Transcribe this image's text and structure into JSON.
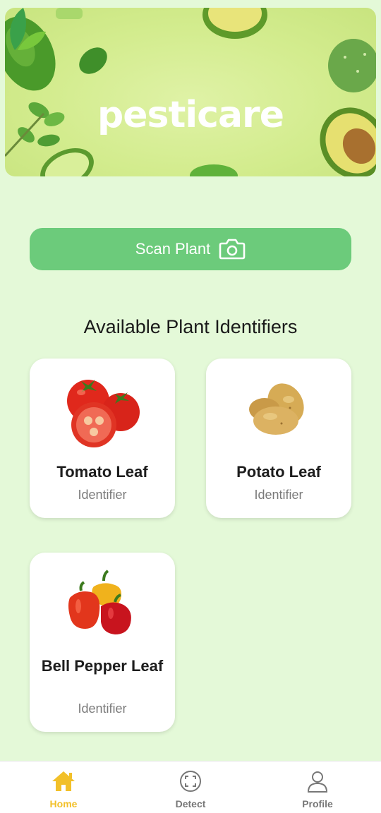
{
  "app": {
    "logo_text": "pesticare"
  },
  "scan_button": {
    "label": "Scan Plant",
    "icon": "camera-icon"
  },
  "section": {
    "title": "Available Plant Identifiers"
  },
  "cards": [
    {
      "name": "Tomato Leaf",
      "subtitle": "Identifier",
      "image": "tomato-image"
    },
    {
      "name": "Potato Leaf",
      "subtitle": "Identifier",
      "image": "potato-image"
    },
    {
      "name": "Bell Pepper Leaf",
      "subtitle": "Identifier",
      "image": "bell-pepper-image"
    }
  ],
  "nav": [
    {
      "label": "Home",
      "icon": "home-icon",
      "active": true
    },
    {
      "label": "Detect",
      "icon": "detect-icon",
      "active": false
    },
    {
      "label": "Profile",
      "icon": "profile-icon",
      "active": false
    }
  ],
  "colors": {
    "background": "#e4f9d8",
    "accent_green": "#6ccb7b",
    "active_nav": "#f2c029",
    "inactive_nav": "#777777"
  }
}
